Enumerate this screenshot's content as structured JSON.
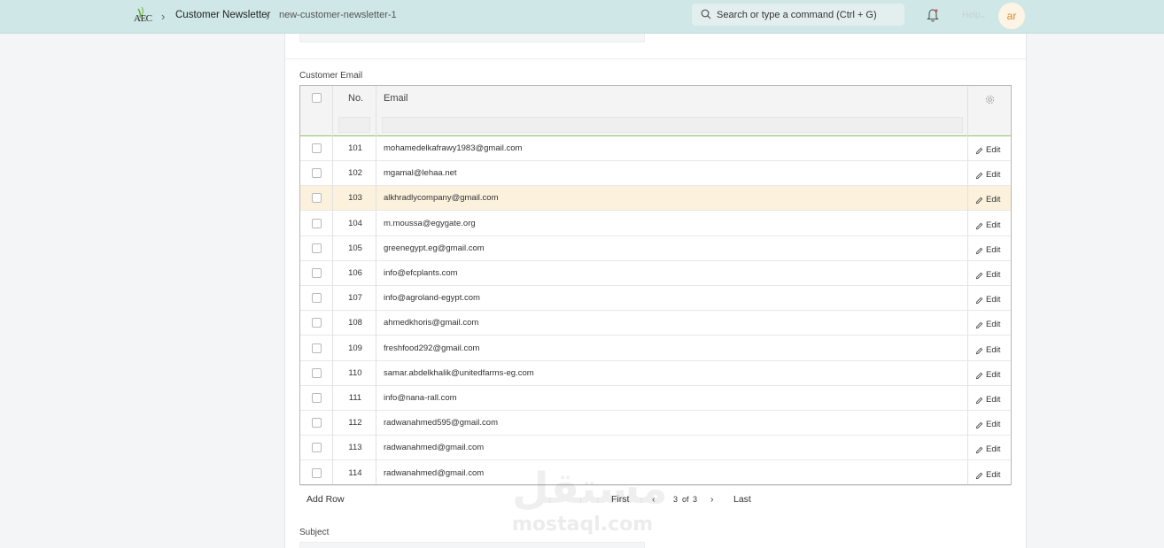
{
  "navbar": {
    "logo_text": "AEC",
    "breadcrumbs": [
      "Customer Newsletter",
      "new-customer-newsletter-1"
    ],
    "search_placeholder": "Search or type a command (Ctrl + G)",
    "help_label": "Help",
    "avatar_initials": "ar"
  },
  "section": {
    "customer_email_label": "Customer Email",
    "subject_label": "Subject"
  },
  "grid": {
    "columns": {
      "no": "No.",
      "email": "Email"
    },
    "edit_label": "Edit",
    "rows": [
      {
        "no": "101",
        "email": "mohamedelkafrawy1983@gmail.com"
      },
      {
        "no": "102",
        "email": "mgamal@lehaa.net"
      },
      {
        "no": "103",
        "email": "alkhradlycompany@gmail.com",
        "highlighted": true
      },
      {
        "no": "104",
        "email": "m.moussa@egygate.org"
      },
      {
        "no": "105",
        "email": "greenegypt.eg@gmail.com"
      },
      {
        "no": "106",
        "email": "info@efcplants.com"
      },
      {
        "no": "107",
        "email": "info@agroland-egypt.com"
      },
      {
        "no": "108",
        "email": "ahmedkhoris@gmail.com"
      },
      {
        "no": "109",
        "email": "freshfood292@gmail.com"
      },
      {
        "no": "110",
        "email": "samar.abdelkhalik@unitedfarms-eg.com"
      },
      {
        "no": "111",
        "email": "info@nana-rall.com"
      },
      {
        "no": "112",
        "email": "radwanahmed595@gmail.com"
      },
      {
        "no": "113",
        "email": "radwanahmed@gmail.com"
      },
      {
        "no": "114",
        "email": "radwanahmed@gmail.com"
      }
    ]
  },
  "footer": {
    "add_row": "Add Row",
    "first": "First",
    "current_page": "3",
    "of": "of",
    "total_pages": "3",
    "last": "Last"
  },
  "watermark": {
    "arabic": "مستقل",
    "latin": "mostaql.com"
  },
  "colors": {
    "navbar_bg": "#cfe7e6",
    "highlight_row": "#fcf1dd",
    "header_underline": "#8cc36a",
    "avatar_text": "#d28b2f"
  }
}
